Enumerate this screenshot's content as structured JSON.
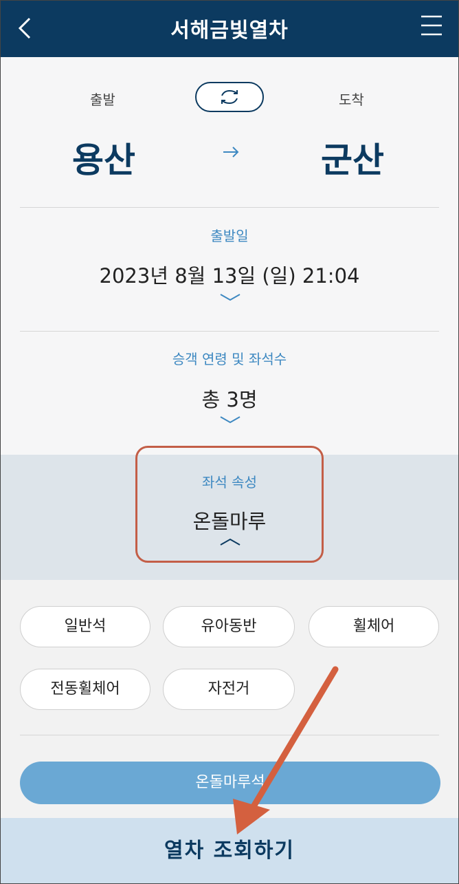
{
  "header": {
    "title": "서해금빛열차",
    "back_icon": "chevron-left-icon",
    "menu_icon": "hamburger-menu-icon"
  },
  "route": {
    "departure_label": "출발",
    "arrival_label": "도착",
    "departure_station": "용산",
    "arrival_station": "군산",
    "swap_icon": "swap-icon",
    "direction_icon": "arrow-right-icon"
  },
  "date_section": {
    "label": "출발일",
    "value": "2023년 8월 13일 (일) 21:04"
  },
  "passenger_section": {
    "label": "승객 연령 및 좌석수",
    "value": "총 3명"
  },
  "seat_attr_section": {
    "label": "좌석 속성",
    "value": "온돌마루"
  },
  "seat_options": [
    {
      "label": "일반석"
    },
    {
      "label": "유아동반"
    },
    {
      "label": "휠체어"
    },
    {
      "label": "전동휠체어"
    },
    {
      "label": "자전거"
    }
  ],
  "selected_option": "온돌마루석",
  "search_button": "열차 조회하기",
  "colors": {
    "header": "#0c3a60",
    "accent": "#3d88c1",
    "selected": "#6aa8d4",
    "annotation": "#c35e47"
  }
}
